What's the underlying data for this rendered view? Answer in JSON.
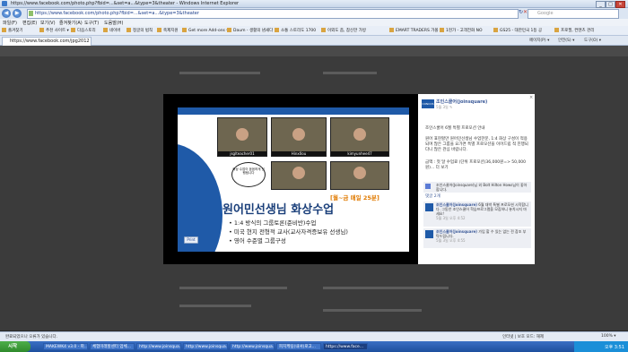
{
  "window": {
    "title": "https://www.facebook.com/photo.php?fbid=...&set=a...&type=3&theater - Windows Internet Explorer",
    "minimize": "_",
    "maximize": "□",
    "close": "✕"
  },
  "address": {
    "url": "https://www.facebook.com/photo.php?fbid=...&set=a...&type=3&theater",
    "search_placeholder": "Google"
  },
  "menu": [
    "파일(F)",
    "편집(E)",
    "보기(V)",
    "즐겨찾기(A)",
    "도구(T)",
    "도움말(H)"
  ],
  "favorites": [
    "즐겨찾기",
    "추천 사이트 ▾",
    "다음스토리",
    "네이버",
    "정글의 법칙",
    "축제지원",
    "Get more Add-ons ▾",
    "Daum - 생활의 냄새다",
    "소통 스토리도 1700",
    "이외도 좀, 참신한 가방",
    "EMART TRADERS 가볼",
    "1현가 - 고객전화 NO",
    "GS25 - 대한민국 1등 공",
    "프로필, 컨텐츠 관리"
  ],
  "tab": {
    "label": "https://www.facebook.com/jpg2012"
  },
  "commands": [
    "페이지(P) ▾",
    "안전(S) ▾",
    "도구(O) ▾"
  ],
  "slide": {
    "cams": [
      {
        "label": "jsglteacher01"
      },
      {
        "label": "Hinx0ou"
      },
      {
        "label": "kimyunhee47"
      },
      {
        "label": ""
      },
      {
        "label": ""
      }
    ],
    "bubble": "화상 수업이 꼼꼼하게 진행됩니다",
    "tagline": "[월~금 매일 25분]",
    "headline": "원어민선생님 화상수업",
    "bullets": [
      "• 1:4 방식의 그룹토론(준비반)수업",
      "• 미국 현지 전형적 교사(교사자격증보유 선생님)",
      "• 영어 수준별 그룹구성"
    ],
    "print_label": "Print"
  },
  "panel": {
    "logo": "CONCOS",
    "name": "조인스쿨어(joinsquare)",
    "date": "5월 3일 ✎",
    "body1": "조인스쿨어 6월 특별 프로모션 안내",
    "body2": "원어 표현할만 원어민선생님 수업한문, 1:4 화상 구성이 적용되며 많은 그룹을 요가면 특별 프로모션을 이어드립 적 진행되다니 많은 관심 바랍니다.",
    "body3": "금액 : 첫 달 수업료 (단위 프로모션(36,000원=> 50,000원)... 더 보기",
    "likes": "조인스쿨어(Joinsquare)님 외 Bolt Hilton Hows님이 좋아합니다.",
    "comment_count": "댓글 2개",
    "comments": [
      {
        "name": "조인스쿨어(Joinsquare)",
        "text": "6월 대박 특별 프로모션 시작합니다. 그동안 조인스쿨어 학습프로그램을 모집하니 놓치시지 마세요!",
        "date": "5월 3일 오후 4:52"
      },
      {
        "name": "조인스쿨어(Joinsquare)",
        "text": "가입 할 수 있는 없는 전 참조 부탁드립니다.",
        "date": "5월 3일 오후 4:55"
      }
    ],
    "close": "×"
  },
  "status": {
    "left": "완료되었으나 오류가 있습니다.",
    "zone": "인터넷 | 보호 모드: 해제",
    "zoom": "100% ▾"
  },
  "taskbar": {
    "start": "시작",
    "tasks": [
      "MAKEWK4 v3.0 - 파...",
      "체험미래할센터 업체...",
      "http://www.joinsqua...",
      "http://www.joinsqua...",
      "http://www.joinsqua...",
      "피치케팅(내셔)로고...",
      "https://www.face..."
    ],
    "clock": "오후 3:51"
  }
}
